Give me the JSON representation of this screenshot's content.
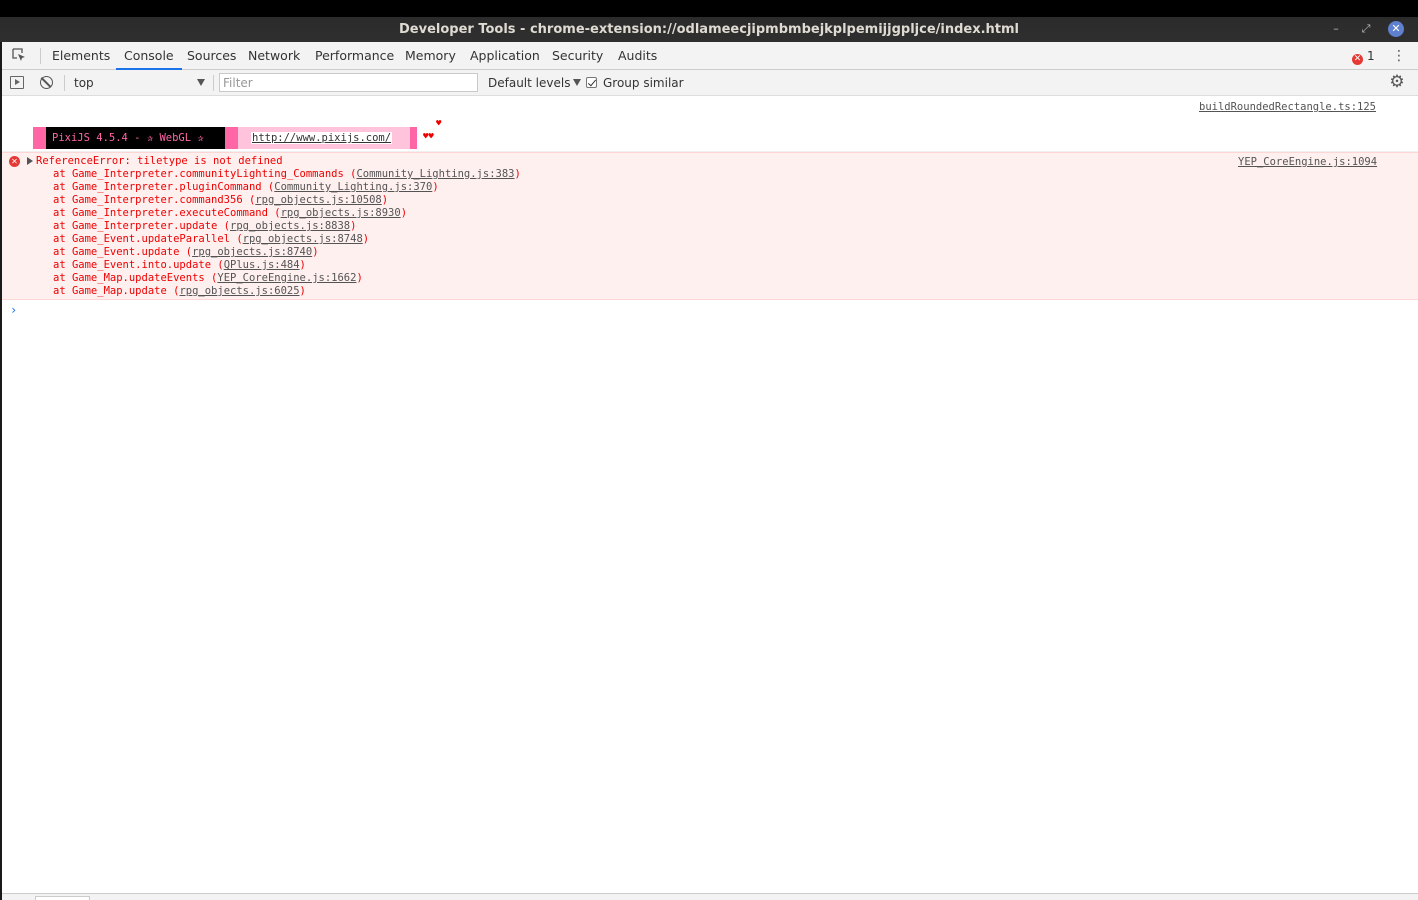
{
  "window": {
    "title": "Developer Tools - chrome-extension://odlameecjipmbmbejkplpemijjgpljce/index.html",
    "minimize_glyph": "–",
    "maximize_glyph": "⤢",
    "close_glyph": "✕"
  },
  "tabs": [
    {
      "label": "Elements"
    },
    {
      "label": "Console",
      "active": true
    },
    {
      "label": "Sources"
    },
    {
      "label": "Network"
    },
    {
      "label": "Performance"
    },
    {
      "label": "Memory"
    },
    {
      "label": "Application"
    },
    {
      "label": "Security"
    },
    {
      "label": "Audits"
    }
  ],
  "error_count": "1",
  "toolbar": {
    "context": "top",
    "filter_placeholder": "Filter",
    "levels_label": "Default levels",
    "group_similar_label": "Group similar",
    "group_similar_checked": true
  },
  "console": {
    "pixi_source": "buildRoundedRectangle.ts:125",
    "pixi_banner": "PixiJS 4.5.4 - ✰ WebGL ✰",
    "pixi_url": "http://www.pixijs.com/",
    "hearts_top": "♥",
    "hearts_bottom": "♥♥",
    "error": {
      "message": "ReferenceError: tiletype is not defined",
      "source": "YEP_CoreEngine.js:1094",
      "stack": [
        {
          "text": "at Game_Interpreter.communityLighting_Commands (",
          "link": "Community_Lighting.js:383",
          "end": ")"
        },
        {
          "text": "at Game_Interpreter.pluginCommand (",
          "link": "Community_Lighting.js:370",
          "end": ")"
        },
        {
          "text": "at Game_Interpreter.command356 (",
          "link": "rpg_objects.js:10508",
          "end": ")"
        },
        {
          "text": "at Game_Interpreter.executeCommand (",
          "link": "rpg_objects.js:8930",
          "end": ")"
        },
        {
          "text": "at Game_Interpreter.update (",
          "link": "rpg_objects.js:8838",
          "end": ")"
        },
        {
          "text": "at Game_Event.updateParallel (",
          "link": "rpg_objects.js:8748",
          "end": ")"
        },
        {
          "text": "at Game_Event.update (",
          "link": "rpg_objects.js:8740",
          "end": ")"
        },
        {
          "text": "at Game_Event.into.update (",
          "link": "QPlus.js:484",
          "end": ")"
        },
        {
          "text": "at Game_Map.updateEvents (",
          "link": "YEP_CoreEngine.js:1662",
          "end": ")"
        },
        {
          "text": "at Game_Map.update (",
          "link": "rpg_objects.js:6025",
          "end": ")"
        }
      ]
    },
    "prompt_glyph": "›"
  },
  "colors": {
    "accent": "#1a73e8",
    "error": "#e53935",
    "error_bg": "#fff0f0",
    "pixi_pink": "#ff66a5"
  }
}
